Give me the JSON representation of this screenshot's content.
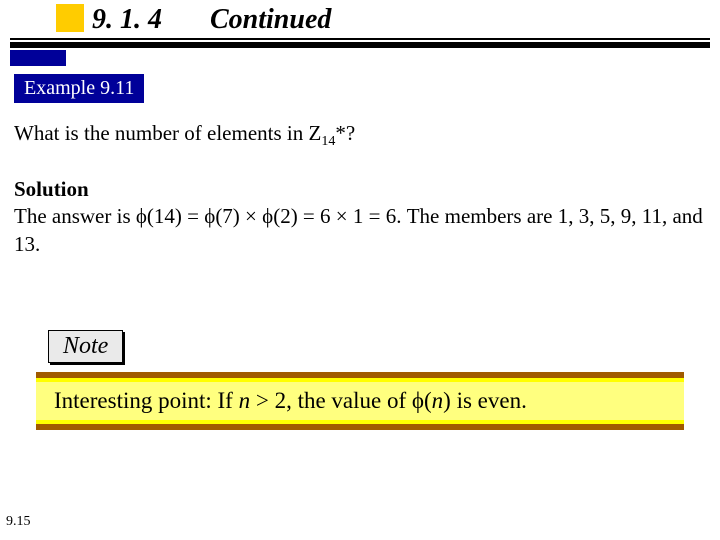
{
  "header": {
    "section": "9. 1. 4",
    "continued": "Continued"
  },
  "example": {
    "tag": "Example 9.11",
    "question_pre": "What is the number of elements in Z",
    "question_sub": "14",
    "question_post": "*?"
  },
  "solution": {
    "heading": "Solution",
    "body": "The answer is ϕ(14) = ϕ(7) × ϕ(2) = 6 × 1 = 6. The members are 1, 3, 5, 9, 11, and 13."
  },
  "note": {
    "label": "Note",
    "text_pre": "Interesting point: If ",
    "text_mid1": "n",
    "text_mid2": " > 2, the value of ϕ(",
    "text_mid3": "n",
    "text_post": ") is even."
  },
  "page_number": "9.15"
}
